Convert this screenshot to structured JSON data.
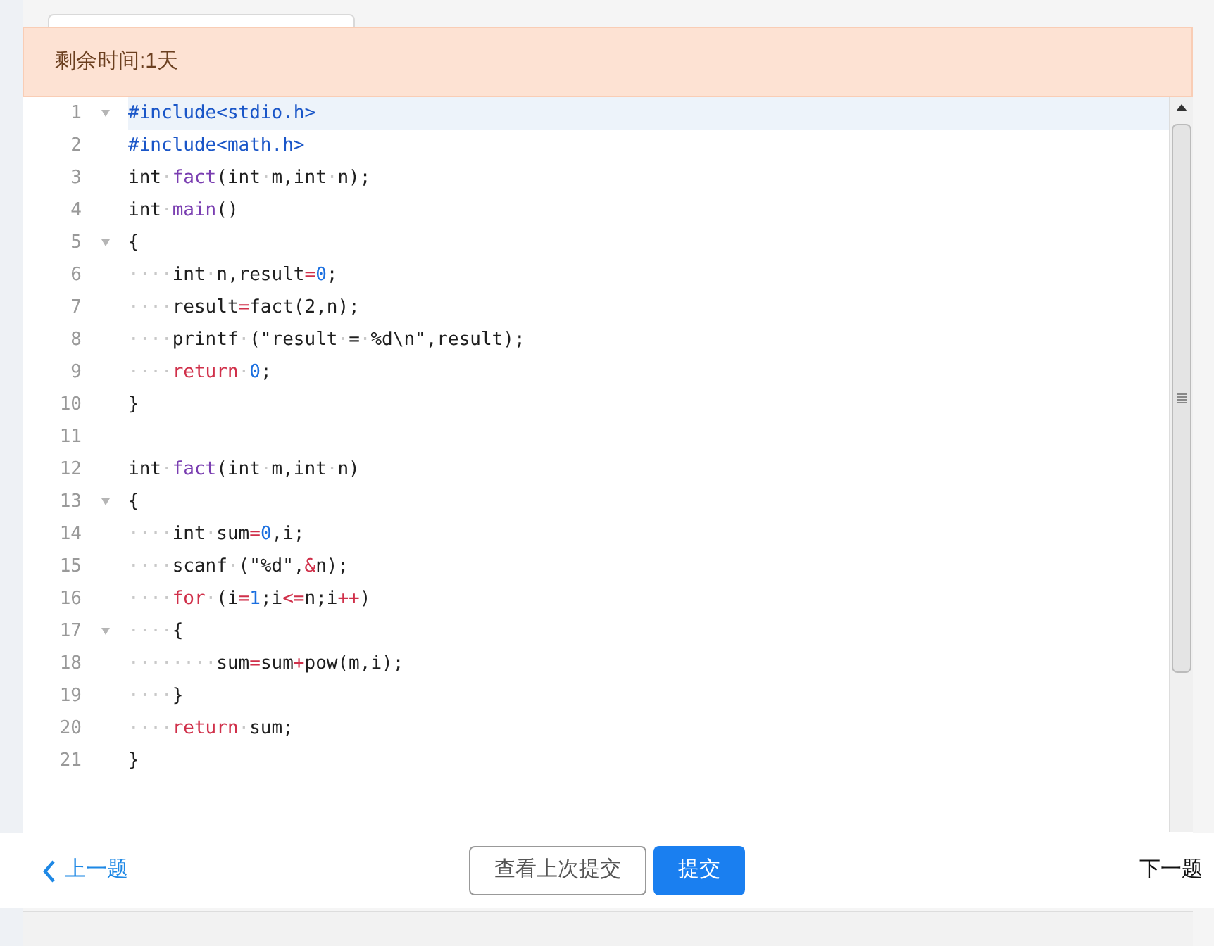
{
  "banner": {
    "text": "剩余时间:1天"
  },
  "editor": {
    "lines": [
      {
        "number": "1",
        "fold": true,
        "active": true,
        "tokens": [
          {
            "kind": "directive",
            "text": "#include<stdio.h>"
          }
        ]
      },
      {
        "number": "2",
        "fold": false,
        "active": false,
        "tokens": [
          {
            "kind": "directive",
            "text": "#include<math.h>"
          }
        ]
      },
      {
        "number": "3",
        "fold": false,
        "active": false,
        "tokens": [
          {
            "kind": "plain",
            "text": "int"
          },
          {
            "kind": "space",
            "text": "·"
          },
          {
            "kind": "func",
            "text": "fact"
          },
          {
            "kind": "plain",
            "text": "(int"
          },
          {
            "kind": "space",
            "text": "·"
          },
          {
            "kind": "plain",
            "text": "m,int"
          },
          {
            "kind": "space",
            "text": "·"
          },
          {
            "kind": "plain",
            "text": "n);"
          }
        ]
      },
      {
        "number": "4",
        "fold": false,
        "active": false,
        "tokens": [
          {
            "kind": "plain",
            "text": "int"
          },
          {
            "kind": "space",
            "text": "·"
          },
          {
            "kind": "func",
            "text": "main"
          },
          {
            "kind": "plain",
            "text": "()"
          }
        ]
      },
      {
        "number": "5",
        "fold": true,
        "active": false,
        "tokens": [
          {
            "kind": "plain",
            "text": "{"
          }
        ]
      },
      {
        "number": "6",
        "fold": false,
        "active": false,
        "tokens": [
          {
            "kind": "space",
            "text": "····"
          },
          {
            "kind": "plain",
            "text": "int"
          },
          {
            "kind": "space",
            "text": "·"
          },
          {
            "kind": "plain",
            "text": "n,result"
          },
          {
            "kind": "op",
            "text": "="
          },
          {
            "kind": "number",
            "text": "0"
          },
          {
            "kind": "plain",
            "text": ";"
          }
        ]
      },
      {
        "number": "7",
        "fold": false,
        "active": false,
        "tokens": [
          {
            "kind": "space",
            "text": "····"
          },
          {
            "kind": "plain",
            "text": "result"
          },
          {
            "kind": "op",
            "text": "="
          },
          {
            "kind": "plain",
            "text": "fact(2,n);"
          }
        ]
      },
      {
        "number": "8",
        "fold": false,
        "active": false,
        "tokens": [
          {
            "kind": "space",
            "text": "····"
          },
          {
            "kind": "plain",
            "text": "printf"
          },
          {
            "kind": "space",
            "text": "·"
          },
          {
            "kind": "plain",
            "text": "(\"result"
          },
          {
            "kind": "space",
            "text": "·"
          },
          {
            "kind": "plain",
            "text": "="
          },
          {
            "kind": "space",
            "text": "·"
          },
          {
            "kind": "plain",
            "text": "%d\\n\",result);"
          }
        ]
      },
      {
        "number": "9",
        "fold": false,
        "active": false,
        "tokens": [
          {
            "kind": "space",
            "text": "····"
          },
          {
            "kind": "keyword",
            "text": "return"
          },
          {
            "kind": "space",
            "text": "·"
          },
          {
            "kind": "number",
            "text": "0"
          },
          {
            "kind": "plain",
            "text": ";"
          }
        ]
      },
      {
        "number": "10",
        "fold": false,
        "active": false,
        "tokens": [
          {
            "kind": "plain",
            "text": "}"
          }
        ]
      },
      {
        "number": "11",
        "fold": false,
        "active": false
      },
      {
        "number": "12",
        "fold": false,
        "active": false,
        "tokens": [
          {
            "kind": "plain",
            "text": "int"
          },
          {
            "kind": "space",
            "text": "·"
          },
          {
            "kind": "func",
            "text": "fact"
          },
          {
            "kind": "plain",
            "text": "(int"
          },
          {
            "kind": "space",
            "text": "·"
          },
          {
            "kind": "plain",
            "text": "m,int"
          },
          {
            "kind": "space",
            "text": "·"
          },
          {
            "kind": "plain",
            "text": "n)"
          }
        ]
      },
      {
        "number": "13",
        "fold": true,
        "active": false,
        "tokens": [
          {
            "kind": "plain",
            "text": "{"
          }
        ]
      },
      {
        "number": "14",
        "fold": false,
        "active": false,
        "tokens": [
          {
            "kind": "space",
            "text": "····"
          },
          {
            "kind": "plain",
            "text": "int"
          },
          {
            "kind": "space",
            "text": "·"
          },
          {
            "kind": "plain",
            "text": "sum"
          },
          {
            "kind": "op",
            "text": "="
          },
          {
            "kind": "number",
            "text": "0"
          },
          {
            "kind": "plain",
            "text": ",i;"
          }
        ]
      },
      {
        "number": "15",
        "fold": false,
        "active": false,
        "tokens": [
          {
            "kind": "space",
            "text": "····"
          },
          {
            "kind": "plain",
            "text": "scanf"
          },
          {
            "kind": "space",
            "text": "·"
          },
          {
            "kind": "plain",
            "text": "(\"%d\","
          },
          {
            "kind": "op",
            "text": "&"
          },
          {
            "kind": "plain",
            "text": "n);"
          }
        ]
      },
      {
        "number": "16",
        "fold": false,
        "active": false,
        "tokens": [
          {
            "kind": "space",
            "text": "····"
          },
          {
            "kind": "keyword",
            "text": "for"
          },
          {
            "kind": "space",
            "text": "·"
          },
          {
            "kind": "plain",
            "text": "(i"
          },
          {
            "kind": "op",
            "text": "="
          },
          {
            "kind": "number",
            "text": "1"
          },
          {
            "kind": "plain",
            "text": ";i"
          },
          {
            "kind": "op",
            "text": "<="
          },
          {
            "kind": "plain",
            "text": "n;i"
          },
          {
            "kind": "op",
            "text": "++"
          },
          {
            "kind": "plain",
            "text": ")"
          }
        ]
      },
      {
        "number": "17",
        "fold": true,
        "active": false,
        "tokens": [
          {
            "kind": "space",
            "text": "····"
          },
          {
            "kind": "plain",
            "text": "{"
          }
        ]
      },
      {
        "number": "18",
        "fold": false,
        "active": false,
        "tokens": [
          {
            "kind": "space",
            "text": "········"
          },
          {
            "kind": "plain",
            "text": "sum"
          },
          {
            "kind": "op",
            "text": "="
          },
          {
            "kind": "plain",
            "text": "sum"
          },
          {
            "kind": "op",
            "text": "+"
          },
          {
            "kind": "plain",
            "text": "pow(m,i);"
          }
        ]
      },
      {
        "number": "19",
        "fold": false,
        "active": false,
        "tokens": [
          {
            "kind": "space",
            "text": "····"
          },
          {
            "kind": "plain",
            "text": "}"
          }
        ]
      },
      {
        "number": "20",
        "fold": false,
        "active": false,
        "tokens": [
          {
            "kind": "space",
            "text": "····"
          },
          {
            "kind": "keyword",
            "text": "return"
          },
          {
            "kind": "space",
            "text": "·"
          },
          {
            "kind": "plain",
            "text": "sum;"
          }
        ]
      },
      {
        "number": "21",
        "fold": false,
        "active": false,
        "tokens": [
          {
            "kind": "plain",
            "text": "}"
          }
        ]
      }
    ]
  },
  "footer": {
    "previous": "上一题",
    "view_last": "查看上次提交",
    "submit": "提交",
    "next": "下一题"
  }
}
